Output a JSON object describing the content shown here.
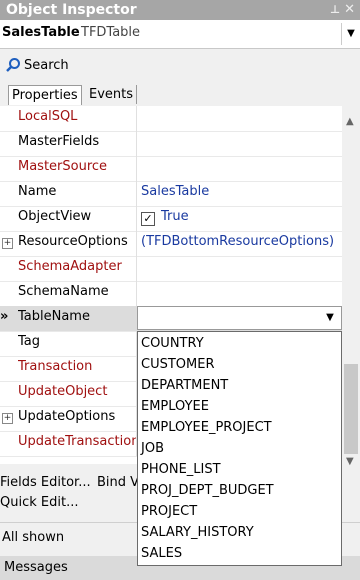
{
  "window": {
    "title": "Object Inspector",
    "pin": "⊥",
    "close": "✕"
  },
  "object": {
    "name": "SalesTable",
    "type": "TFDTable",
    "dropdown": "▼"
  },
  "search": {
    "label": "Search"
  },
  "tabs": [
    {
      "label": "Properties"
    },
    {
      "label": "Events"
    }
  ],
  "properties": [
    {
      "name": "LocalSQL",
      "value": ""
    },
    {
      "name": "MasterFields",
      "value": ""
    },
    {
      "name": "MasterSource",
      "value": ""
    },
    {
      "name": "Name",
      "value": "SalesTable"
    },
    {
      "name": "ObjectView",
      "value": "True",
      "check": "✓"
    },
    {
      "name": "ResourceOptions",
      "value": "(TFDBottomResourceOptions)",
      "expander": "+"
    },
    {
      "name": "SchemaAdapter",
      "value": ""
    },
    {
      "name": "SchemaName",
      "value": ""
    },
    {
      "name": "TableName",
      "value": "",
      "marker": "»"
    },
    {
      "name": "Tag",
      "value": ""
    },
    {
      "name": "Transaction",
      "value": ""
    },
    {
      "name": "UpdateObject",
      "value": ""
    },
    {
      "name": "UpdateOptions",
      "value": "",
      "expander": "+"
    },
    {
      "name": "UpdateTransaction",
      "value": ""
    }
  ],
  "table_dropdown": {
    "arrow": "▼",
    "options": [
      "COUNTRY",
      "CUSTOMER",
      "DEPARTMENT",
      "EMPLOYEE",
      "EMPLOYEE_PROJECT",
      "JOB",
      "PHONE_LIST",
      "PROJ_DEPT_BUDGET",
      "PROJECT",
      "SALARY_HISTORY",
      "SALES"
    ]
  },
  "scrollbar": {
    "up": "▲",
    "down": "▼"
  },
  "links": {
    "fields_editor": "Fields Editor...",
    "bind_visually": "Bind V",
    "quick_edit": "Quick Edit..."
  },
  "status": {
    "filter": "All shown"
  },
  "bottom_panel": {
    "messages": "Messages"
  },
  "colors": {
    "title_bar": "#a6a6a6",
    "highlight_property": "#a01010",
    "value_text": "#1a3aa0"
  }
}
